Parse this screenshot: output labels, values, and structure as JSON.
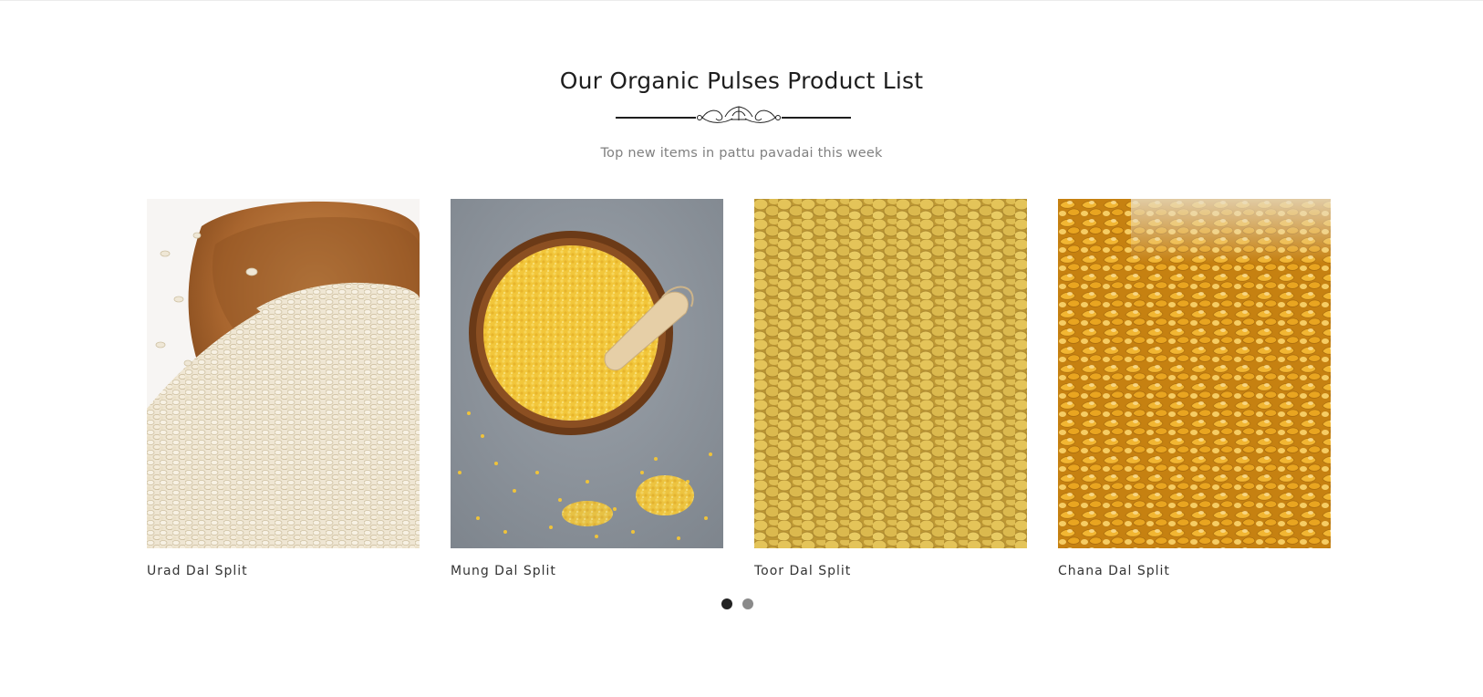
{
  "section": {
    "title": "Our Organic Pulses Product List",
    "subtitle": "Top new items in pattu pavadai this week"
  },
  "products": [
    {
      "name": "Urad Dal Split",
      "image": "urad-dal-split-image"
    },
    {
      "name": "Mung Dal Split",
      "image": "mung-dal-split-image"
    },
    {
      "name": "Toor Dal Split",
      "image": "toor-dal-split-image"
    },
    {
      "name": "Chana Dal Split",
      "image": "chana-dal-split-image"
    }
  ],
  "pagination": {
    "dots": 2,
    "active_index": 0
  },
  "colors": {
    "title": "#1e1e1e",
    "subtitle": "#808080",
    "dot_active": "#222222",
    "dot_inactive": "#8a8a8a",
    "divider": "#1e1e1e"
  }
}
